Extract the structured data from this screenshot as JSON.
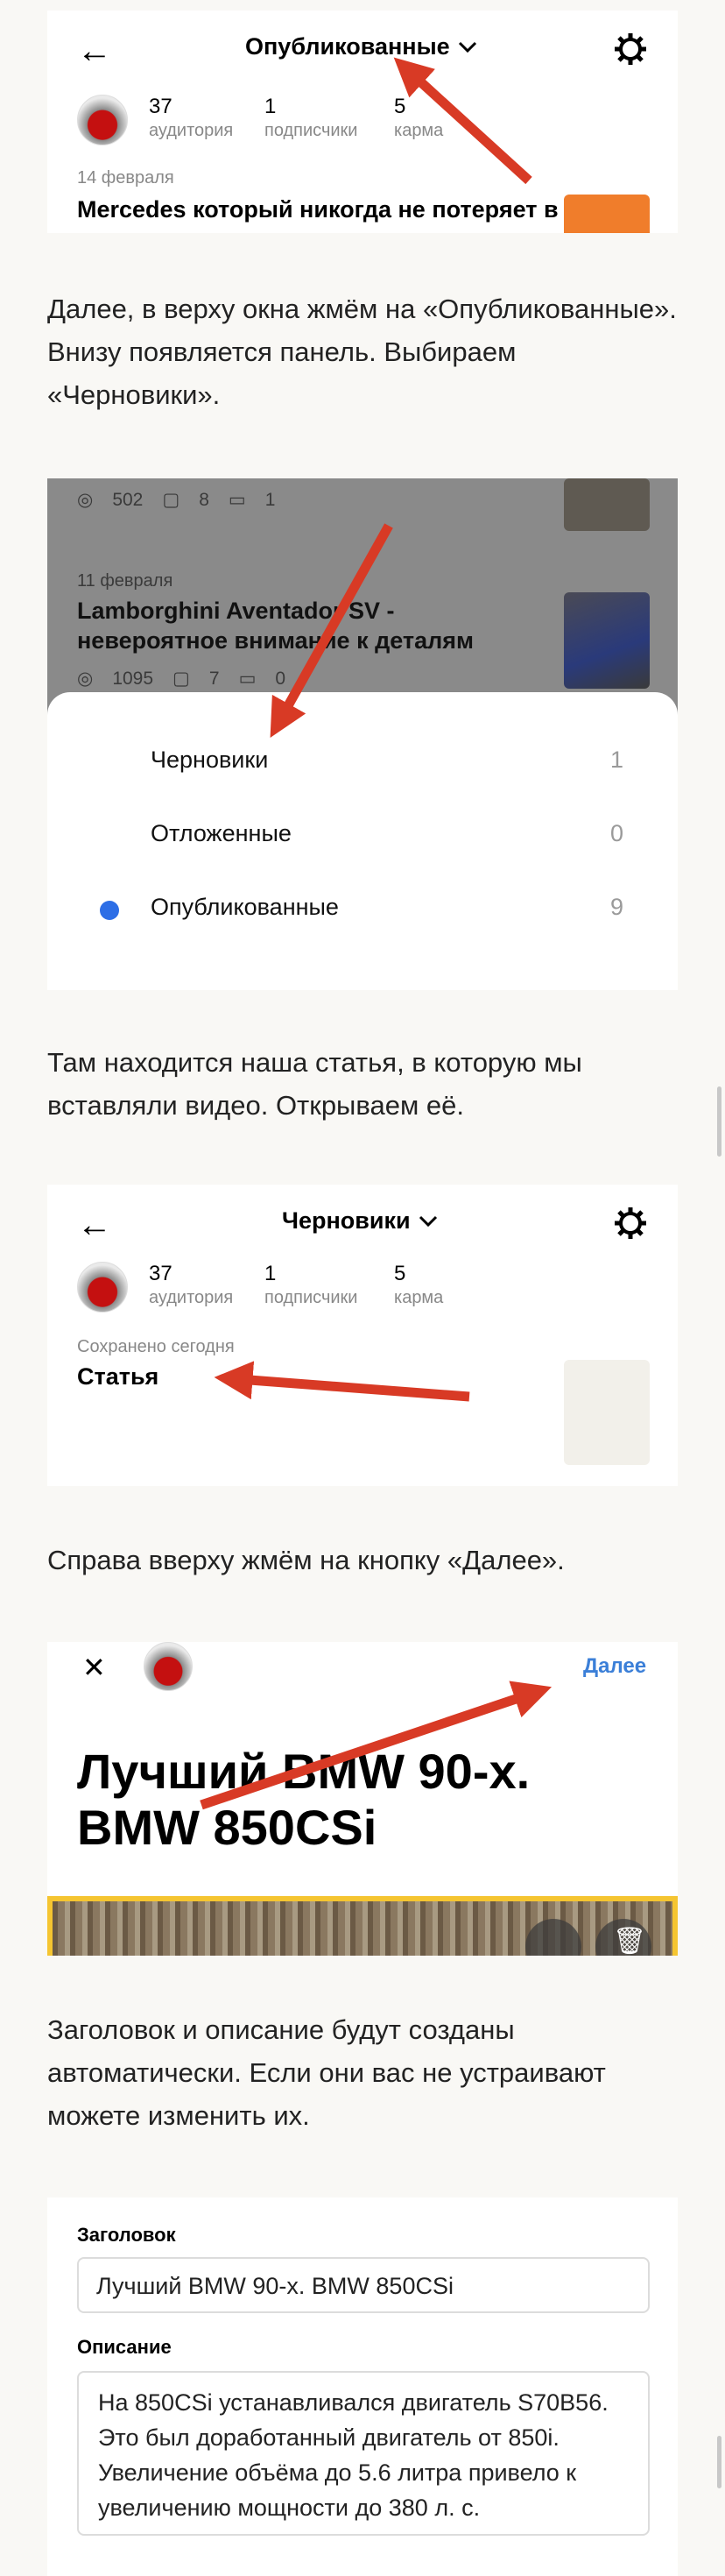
{
  "screen1": {
    "title": "Опубликованные",
    "back_icon": "←",
    "chevron": "⌄",
    "settings_icon": "⚙",
    "stats": [
      {
        "value": "37",
        "label": "аудитория"
      },
      {
        "value": "1",
        "label": "подписчики"
      },
      {
        "value": "5",
        "label": "карма"
      }
    ],
    "article_date": "14 февраля",
    "article_title": "Mercedes который никогда не потеряет в цене",
    "accent_color": "#f07d2b"
  },
  "text1": "Далее, в верху окна жмём на «Опубликованные». Внизу появляется панель. Выбираем «Черновики».",
  "screen2": {
    "meta_top": {
      "views": "502",
      "reads": "8",
      "comments": "1"
    },
    "article_date": "11 февраля",
    "article_title_1": "Lamborghini Aventador SV -",
    "article_title_2": "невероятное внимание к деталям",
    "meta_bottom": {
      "views": "1095",
      "reads": "7",
      "comments": "0"
    },
    "options": [
      {
        "label": "Черновики",
        "count": "1",
        "selected": false
      },
      {
        "label": "Отложенные",
        "count": "0",
        "selected": false
      },
      {
        "label": "Опубликованные",
        "count": "9",
        "selected": true
      }
    ],
    "selected_color": "#2d6ee6"
  },
  "text2": "Там находится наша статья, в которую мы вставляли видео. Открываем её.",
  "screen3": {
    "title": "Черновики",
    "stats": [
      {
        "value": "37",
        "label": "аудитория"
      },
      {
        "value": "1",
        "label": "подписчики"
      },
      {
        "value": "5",
        "label": "карма"
      }
    ],
    "saved_label": "Сохранено сегодня",
    "article_title": "Статья"
  },
  "text3": "Справа вверху жмём на кнопку «Далее».",
  "screen4": {
    "close_icon": "✕",
    "next_label": "Далее",
    "headline_1": "Лучший BMW 90-х.",
    "headline_2": "BMW 850CSi",
    "link_color": "#3b7fd8",
    "frame_color": "#f5c531"
  },
  "text4": "Заголовок и описание будут созданы автоматически. Если они вас не устраивают можете изменить их.",
  "screen5": {
    "title_label": "Заголовок",
    "title_value": "Лучший BMW 90-х. BMW 850CSi",
    "desc_label": "Описание",
    "desc_value": "На 850CSi устанавливался двигатель S70B56. Это был доработанный двигатель от 850i. Увеличение объёма до 5.6 литра привело к увеличению мощности до 380 л. с."
  },
  "arrow_color": "#d83a25"
}
